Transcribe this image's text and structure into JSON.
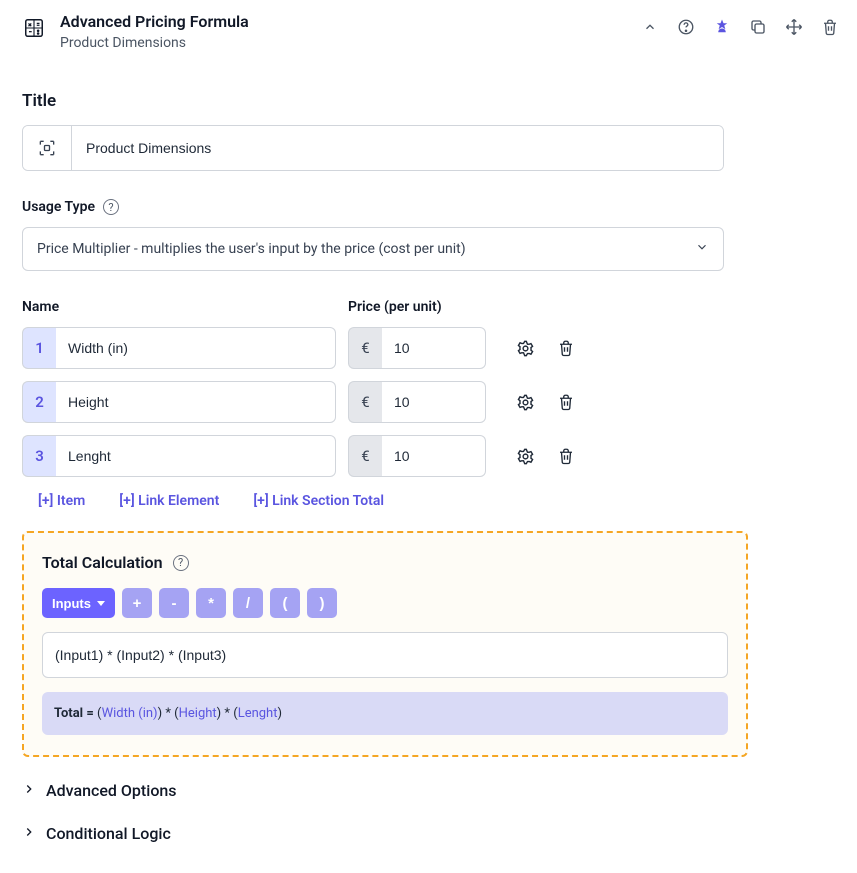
{
  "header": {
    "title": "Advanced Pricing Formula",
    "subtitle": "Product Dimensions"
  },
  "title_section": {
    "label": "Title",
    "value": "Product Dimensions"
  },
  "usage": {
    "label": "Usage Type",
    "selected": "Price Multiplier - multiplies the user's input by the price (cost per unit)"
  },
  "items": {
    "name_header": "Name",
    "price_header": "Price (per unit)",
    "currency": "€",
    "rows": [
      {
        "index": "1",
        "name": "Width (in)",
        "price": "10"
      },
      {
        "index": "2",
        "name": "Height",
        "price": "10"
      },
      {
        "index": "3",
        "name": "Lenght",
        "price": "10"
      }
    ],
    "add_links": {
      "item": "[+] Item",
      "link_element": "[+] Link Element",
      "link_section_total": "[+] Link Section Total"
    }
  },
  "calculation": {
    "title": "Total Calculation",
    "operators": {
      "inputs": "Inputs",
      "plus": "+",
      "minus": "-",
      "mult": "*",
      "div": "/",
      "lparen": "(",
      "rparen": ")"
    },
    "formula": "(Input1) * (Input2) * (Input3)",
    "preview_prefix": "Total = ",
    "preview_tokens": {
      "p1": "(",
      "t1": "Width (in)",
      "p2": ") * (",
      "t2": "Height",
      "p3": ") * (",
      "t3": "Lenght",
      "p4": ")"
    }
  },
  "sections": {
    "advanced": "Advanced Options",
    "conditional": "Conditional Logic"
  }
}
